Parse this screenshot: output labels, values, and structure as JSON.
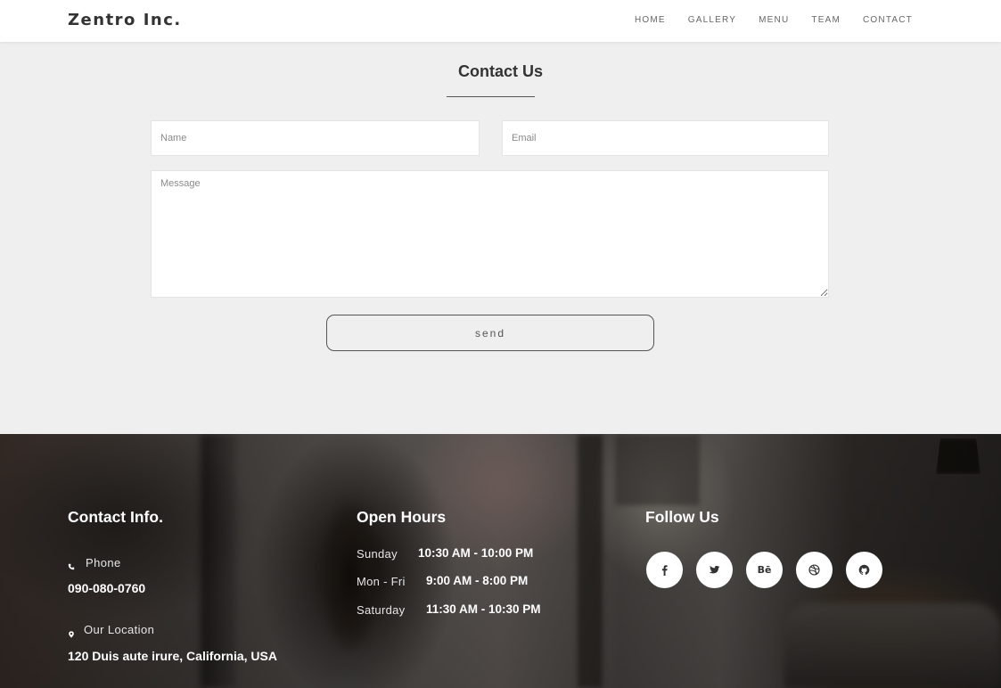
{
  "navbar": {
    "brand": "Zentro Inc.",
    "links": [
      "HOME",
      "GALLERY",
      "MENU",
      "TEAM",
      "CONTACT"
    ]
  },
  "contact": {
    "title": "Contact Us",
    "name_placeholder": "Name",
    "email_placeholder": "Email",
    "message_placeholder": "Message",
    "send_label": "send"
  },
  "footer": {
    "contact_info": {
      "heading": "Contact Info.",
      "phone_label": "Phone",
      "phone_value": "090-080-0760",
      "phone_icon": "phone-icon",
      "location_label": "Our Location",
      "location_value": "120 Duis aute irure, California, USA",
      "location_icon": "map-marker-icon"
    },
    "open_hours": {
      "heading": "Open Hours",
      "rows": [
        {
          "day": "Sunday",
          "time": "10:30 AM - 10:00 PM"
        },
        {
          "day": "Mon - Fri",
          "time": "9:00 AM - 8:00 PM"
        },
        {
          "day": "Saturday",
          "time": "11:30 AM - 10:30 PM"
        }
      ]
    },
    "follow": {
      "heading": "Follow Us",
      "icons": [
        "facebook-icon",
        "twitter-icon",
        "behance-icon",
        "dribbble-icon",
        "github-icon"
      ],
      "behance_text": "Bē"
    }
  },
  "colors": {
    "page_bg": "#efefef",
    "navbar_bg": "#ffffff",
    "button_border": "#555555"
  }
}
